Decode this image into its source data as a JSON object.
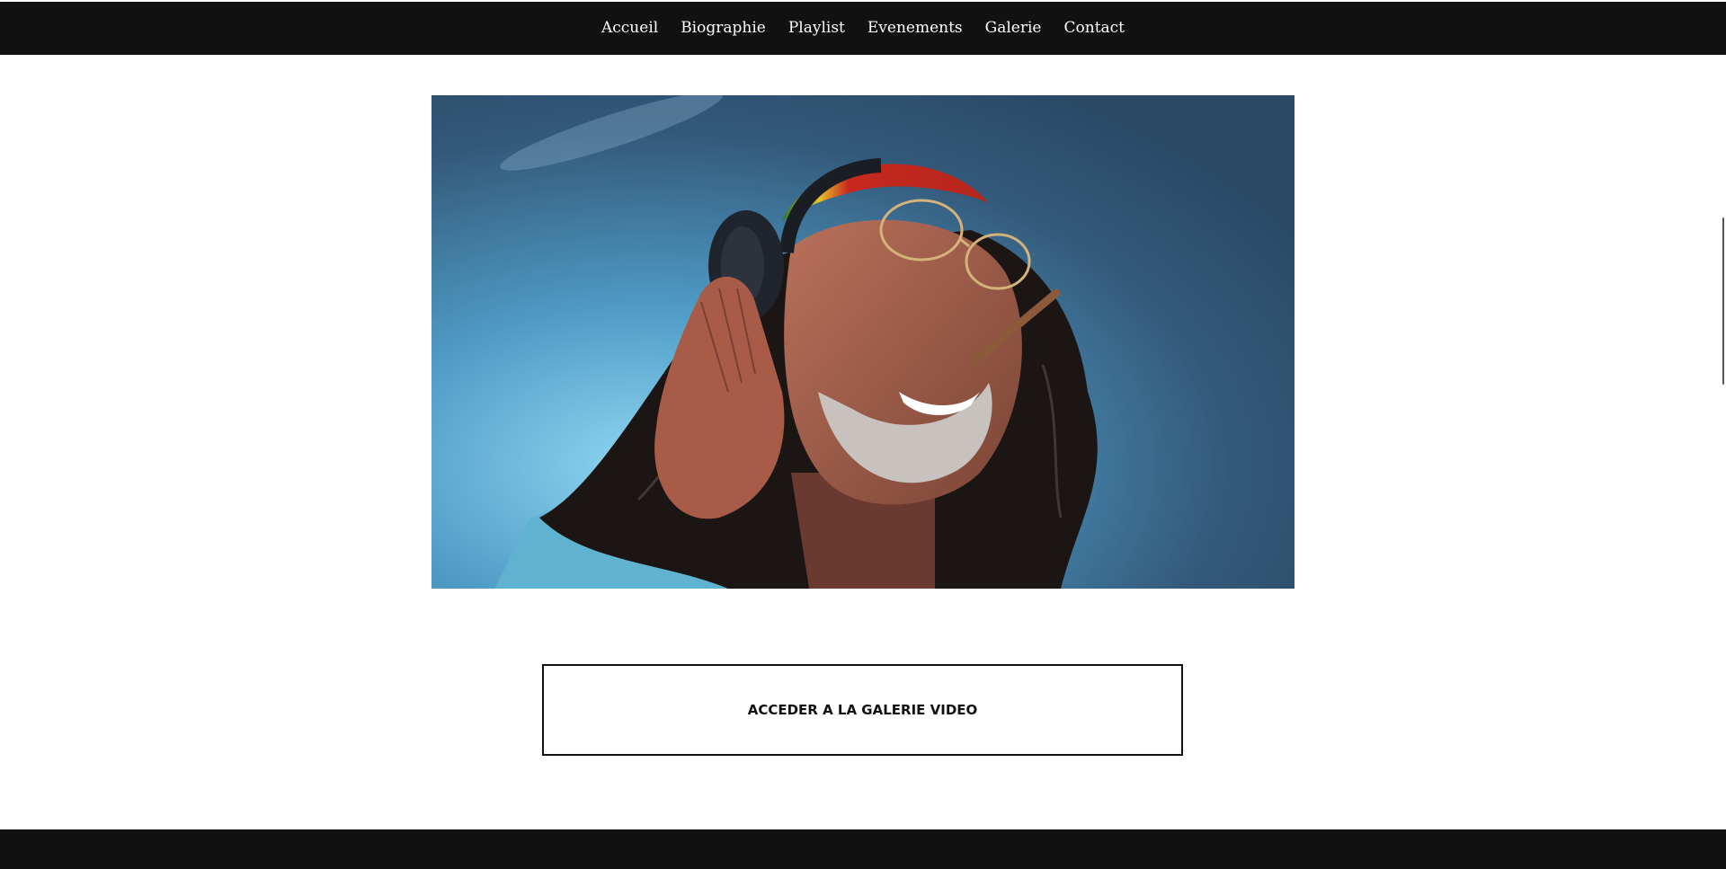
{
  "nav": {
    "items": [
      {
        "label": "Accueil"
      },
      {
        "label": "Biographie"
      },
      {
        "label": "Playlist"
      },
      {
        "label": "Evenements"
      },
      {
        "label": "Galerie"
      },
      {
        "label": "Contact"
      }
    ]
  },
  "hero": {
    "image": "man-with-headphones-photo"
  },
  "cta": {
    "label": "ACCEDER A LA GALERIE VIDEO"
  },
  "colors": {
    "bar": "#111111",
    "background": "#ffffff",
    "text_light": "#ffffff",
    "text_dark": "#111111"
  }
}
